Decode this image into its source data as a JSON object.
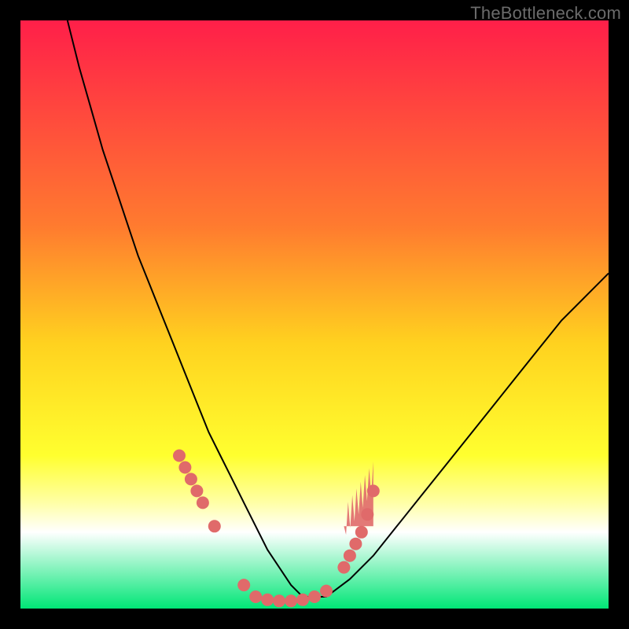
{
  "watermark": "TheBottleneck.com",
  "chart_data": {
    "type": "line",
    "title": "",
    "xlabel": "",
    "ylabel": "",
    "xlim": [
      0,
      100
    ],
    "ylim": [
      0,
      100
    ],
    "gradient_stops": [
      {
        "offset": 0,
        "color": "#ff1f49"
      },
      {
        "offset": 35,
        "color": "#ff7b2f"
      },
      {
        "offset": 55,
        "color": "#ffd21f"
      },
      {
        "offset": 74,
        "color": "#ffff2f"
      },
      {
        "offset": 82,
        "color": "#ffffa6"
      },
      {
        "offset": 87,
        "color": "#ffffff"
      },
      {
        "offset": 100,
        "color": "#00e676"
      }
    ],
    "series": [
      {
        "name": "bottleneck-curve",
        "color": "#000000",
        "stroke_width": 2,
        "x": [
          8,
          10,
          12,
          14,
          16,
          18,
          20,
          22,
          24,
          26,
          28,
          30,
          32,
          34,
          36,
          38,
          40,
          42,
          44,
          46,
          48,
          52,
          56,
          60,
          64,
          68,
          72,
          76,
          80,
          84,
          88,
          92,
          96,
          100
        ],
        "y": [
          100,
          92,
          85,
          78,
          72,
          66,
          60,
          55,
          50,
          45,
          40,
          35,
          30,
          26,
          22,
          18,
          14,
          10,
          7,
          4,
          2,
          2,
          5,
          9,
          14,
          19,
          24,
          29,
          34,
          39,
          44,
          49,
          53,
          57
        ]
      }
    ],
    "markers": {
      "name": "sample-points",
      "color": "#e06a6a",
      "radius": 8,
      "points": [
        {
          "x": 27,
          "y": 26
        },
        {
          "x": 28,
          "y": 24
        },
        {
          "x": 29,
          "y": 22
        },
        {
          "x": 30,
          "y": 20
        },
        {
          "x": 31,
          "y": 18
        },
        {
          "x": 33,
          "y": 14
        },
        {
          "x": 38,
          "y": 4
        },
        {
          "x": 40,
          "y": 2
        },
        {
          "x": 42,
          "y": 1.5
        },
        {
          "x": 44,
          "y": 1.3
        },
        {
          "x": 46,
          "y": 1.3
        },
        {
          "x": 48,
          "y": 1.5
        },
        {
          "x": 50,
          "y": 2
        },
        {
          "x": 52,
          "y": 3
        },
        {
          "x": 55,
          "y": 7
        },
        {
          "x": 56,
          "y": 9
        },
        {
          "x": 57,
          "y": 11
        },
        {
          "x": 58,
          "y": 13
        },
        {
          "x": 59,
          "y": 16
        },
        {
          "x": 60,
          "y": 20
        }
      ]
    },
    "jagged_region": {
      "name": "noise-band",
      "color": "#e06a6a",
      "x_range": [
        55,
        60
      ],
      "y_range": [
        14,
        22
      ]
    }
  }
}
